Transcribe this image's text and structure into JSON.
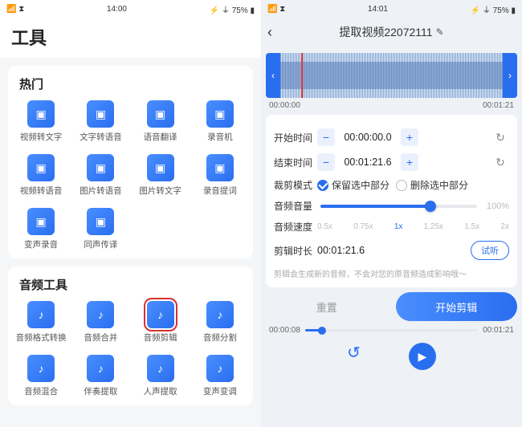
{
  "status": {
    "left_signal": "📶 ⧗",
    "time_left": "14:00",
    "time_right": "14:01",
    "battery": "⚡ ⏚ 75% ▮"
  },
  "left": {
    "page_title": "工具",
    "section_hot": "热门",
    "section_audio": "音频工具",
    "hot": [
      "视频转文字",
      "文字转语音",
      "语音翻译",
      "录音机",
      "视频转语音",
      "图片转语音",
      "图片转文字",
      "录音提词",
      "变声录音",
      "同声传译"
    ],
    "audio": [
      "音频格式转换",
      "音频合并",
      "音频剪辑",
      "音频分割",
      "音频混合",
      "伴奏提取",
      "人声提取",
      "变声变调"
    ],
    "highlighted_index": 2
  },
  "right": {
    "title": "提取视频22072111",
    "wave_start": "00:00:00",
    "wave_end": "00:01:21",
    "start_label": "开始时间",
    "start_value": "00:00:00.0",
    "end_label": "结束时间",
    "end_value": "00:01:21.6",
    "mode_label": "裁剪模式",
    "mode_keep": "保留选中部分",
    "mode_delete": "删除选中部分",
    "volume_label": "音频音量",
    "volume_pct": "100%",
    "speed_label": "音频速度",
    "speed_ticks": [
      "0.5x",
      "0.75x",
      "1x",
      "1.25x",
      "1.5x",
      "2x"
    ],
    "speed_active": 2,
    "duration_label": "剪辑时长",
    "duration_value": "00:01:21.6",
    "try_label": "试听",
    "hint": "剪辑会生成新的音频，不会对您的原音频造成影响哦～",
    "reset_btn": "重置",
    "start_btn": "开始剪辑",
    "play_pos": "00:00:08",
    "play_total": "00:01:21"
  }
}
